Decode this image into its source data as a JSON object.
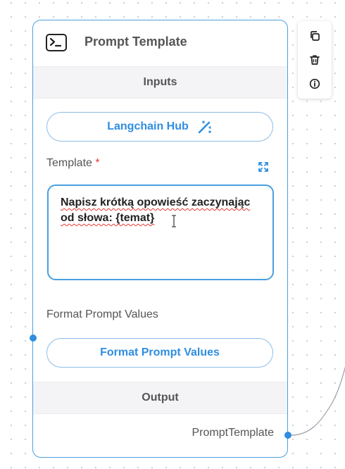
{
  "node": {
    "title": "Prompt Template",
    "icon": "terminal-icon",
    "inputs_header": "Inputs",
    "hub_button": "Langchain Hub",
    "template_label": "Template",
    "required_mark": "*",
    "template_line1": "Napisz krótką opowieść zaczynając",
    "template_line2": "od słowa: {temat}",
    "format_label": "Format Prompt Values",
    "format_button": "Format Prompt Values",
    "output_header": "Output",
    "output_label": "PromptTemplate"
  },
  "toolbar": {
    "icons": [
      "copy-icon",
      "trash-icon",
      "info-icon"
    ]
  },
  "colors": {
    "accent": "#2f8de0",
    "border": "#4a9fe0",
    "required": "#e53935"
  }
}
